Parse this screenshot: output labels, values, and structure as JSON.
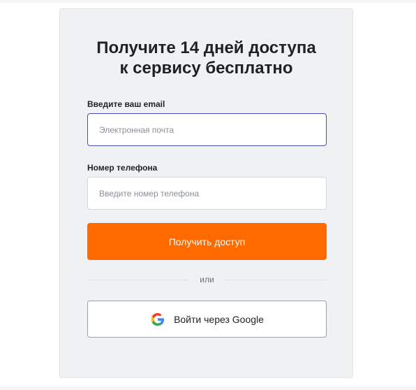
{
  "form": {
    "title_line1": "Получите 14 дней доступа",
    "title_line2": "к сервису бесплатно",
    "email_label": "Введите ваш email",
    "email_placeholder": "Электронная почта",
    "email_value": "",
    "phone_label": "Номер телефона",
    "phone_placeholder": "Введите номер телефона",
    "phone_value": "",
    "submit_label": "Получить доступ",
    "divider_text": "или",
    "google_label": "Войти через Google"
  },
  "colors": {
    "accent": "#ff6a00",
    "card_background": "#f0f1f3",
    "focus_border": "#4a4fb5"
  },
  "icons": {
    "google": "google-g-logo-icon"
  }
}
